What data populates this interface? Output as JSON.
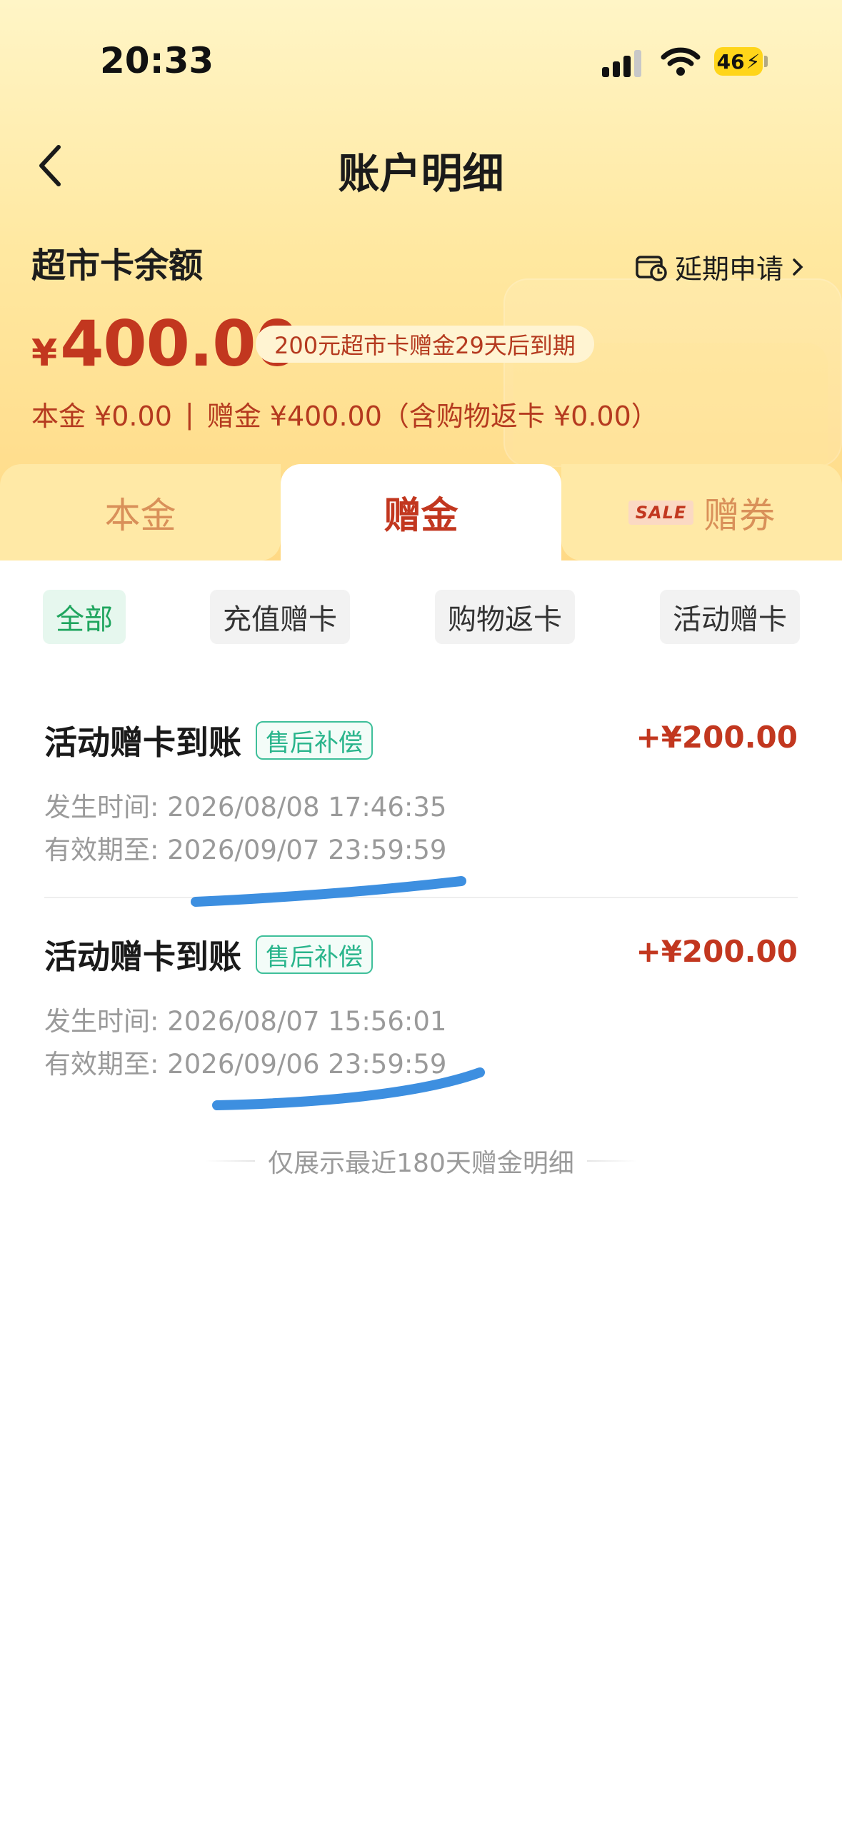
{
  "status_bar": {
    "time": "20:33",
    "battery": "46"
  },
  "nav": {
    "title": "账户明细"
  },
  "balance": {
    "label": "超市卡余额",
    "extend_label": "延期申请",
    "currency": "¥",
    "amount": "400.00",
    "expire_notice": "200元超市卡赠金29天后到期",
    "breakdown_principal": "本金 ¥0.00",
    "breakdown_separator": "|",
    "breakdown_bonus": "赠金 ¥400.00（含购物返卡 ¥0.00）"
  },
  "tabs": {
    "principal": "本金",
    "bonus": "赠金",
    "sale_badge": "SALE",
    "coupon": "赠券"
  },
  "filters": [
    "全部",
    "充值赠卡",
    "购物返卡",
    "活动赠卡"
  ],
  "records": [
    {
      "title": "活动赠卡到账",
      "tag": "售后补偿",
      "amount": "+¥200.00",
      "occurred": "发生时间: 2026/08/08 17:46:35",
      "valid_until": "有效期至: 2026/09/07 23:59:59"
    },
    {
      "title": "活动赠卡到账",
      "tag": "售后补偿",
      "amount": "+¥200.00",
      "occurred": "发生时间: 2026/08/07 15:56:01",
      "valid_until": "有效期至: 2026/09/06 23:59:59"
    }
  ],
  "footer_note": "仅展示最近180天赠金明细",
  "colors": {
    "accent_red": "#c2371f",
    "accent_green": "#1fa55e",
    "annotation_blue": "#3d8fe0"
  }
}
